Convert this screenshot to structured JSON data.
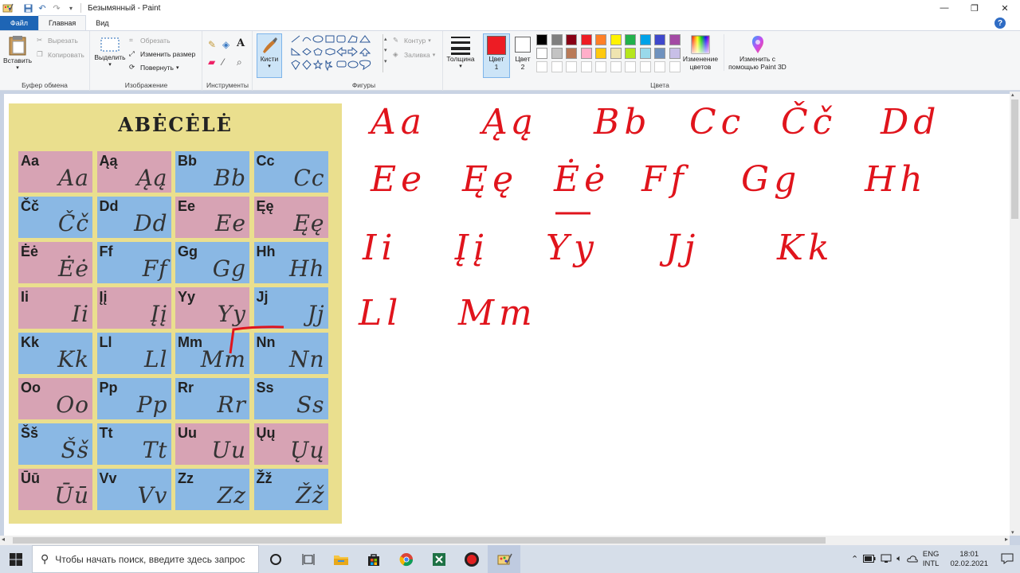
{
  "window": {
    "title": "Безымянный - Paint",
    "controls": {
      "minimize": "—",
      "maximize": "❐",
      "close": "✕"
    }
  },
  "tabs": [
    {
      "label": "Файл"
    },
    {
      "label": "Главная"
    },
    {
      "label": "Вид"
    }
  ],
  "ribbon": {
    "clipboard": {
      "paste": "Вставить",
      "cut": "Вырезать",
      "copy": "Копировать",
      "group": "Буфер обмена"
    },
    "image": {
      "select": "Выделить",
      "crop": "Обрезать",
      "resize": "Изменить размер",
      "rotate": "Повернуть",
      "group": "Изображение"
    },
    "tools": {
      "group": "Инструменты"
    },
    "brushes": {
      "label": "Кисти"
    },
    "shapes": {
      "outline": "Контур",
      "fill": "Заливка",
      "group": "Фигуры"
    },
    "thickness": {
      "label": "Толщина"
    },
    "color1": {
      "label1": "Цвет",
      "label2": "1",
      "value": "#ed1c24"
    },
    "color2": {
      "label1": "Цвет",
      "label2": "2",
      "value": "#ffffff"
    },
    "colors": {
      "group": "Цвета",
      "edit": "Изменение цветов",
      "paint3d": "Изменить с помощью Paint 3D"
    },
    "palette_row1": [
      "#000000",
      "#7f7f7f",
      "#880015",
      "#ed1c24",
      "#ff7f27",
      "#fff200",
      "#22b14c",
      "#00a2e8",
      "#3f48cc",
      "#a349a4"
    ],
    "palette_row2": [
      "#ffffff",
      "#c3c3c3",
      "#b97a57",
      "#ffaec9",
      "#ffc90e",
      "#efe4b0",
      "#b5e61d",
      "#99d9ea",
      "#7092be",
      "#c8bfe7"
    ]
  },
  "poster": {
    "title": "ABĖCĖLĖ",
    "cells": [
      {
        "print": "Aa",
        "script": "Aa",
        "color": "pink"
      },
      {
        "print": "Ąą",
        "script": "Ąą",
        "color": "pink"
      },
      {
        "print": "Bb",
        "script": "Bb",
        "color": "blue"
      },
      {
        "print": "Cc",
        "script": "Cc",
        "color": "blue"
      },
      {
        "print": "Čč",
        "script": "Čč",
        "color": "blue"
      },
      {
        "print": "Dd",
        "script": "Dd",
        "color": "blue"
      },
      {
        "print": "Ee",
        "script": "Ee",
        "color": "pink"
      },
      {
        "print": "Ęę",
        "script": "Ęę",
        "color": "pink"
      },
      {
        "print": "Ėė",
        "script": "Ėė",
        "color": "pink"
      },
      {
        "print": "Ff",
        "script": "Ff",
        "color": "blue"
      },
      {
        "print": "Gg",
        "script": "Gg",
        "color": "blue"
      },
      {
        "print": "Hh",
        "script": "Hh",
        "color": "blue"
      },
      {
        "print": "Ii",
        "script": "Ii",
        "color": "pink"
      },
      {
        "print": "Įį",
        "script": "Įį",
        "color": "pink"
      },
      {
        "print": "Yy",
        "script": "Yy",
        "color": "pink"
      },
      {
        "print": "Jj",
        "script": "Jj",
        "color": "blue"
      },
      {
        "print": "Kk",
        "script": "Kk",
        "color": "blue"
      },
      {
        "print": "Ll",
        "script": "Ll",
        "color": "blue"
      },
      {
        "print": "Mm",
        "script": "Mm",
        "color": "blue"
      },
      {
        "print": "Nn",
        "script": "Nn",
        "color": "blue"
      },
      {
        "print": "Oo",
        "script": "Oo",
        "color": "pink"
      },
      {
        "print": "Pp",
        "script": "Pp",
        "color": "blue"
      },
      {
        "print": "Rr",
        "script": "Rr",
        "color": "blue"
      },
      {
        "print": "Ss",
        "script": "Ss",
        "color": "blue"
      },
      {
        "print": "Šš",
        "script": "Šš",
        "color": "blue"
      },
      {
        "print": "Tt",
        "script": "Tt",
        "color": "blue"
      },
      {
        "print": "Uu",
        "script": "Uu",
        "color": "pink"
      },
      {
        "print": "Ųų",
        "script": "Ųų",
        "color": "pink"
      },
      {
        "print": "Ūū",
        "script": "Ūū",
        "color": "pink"
      },
      {
        "print": "Vv",
        "script": "Vv",
        "color": "blue"
      },
      {
        "print": "Zz",
        "script": "Zz",
        "color": "blue"
      },
      {
        "print": "Žž",
        "script": "Žž",
        "color": "blue"
      }
    ]
  },
  "handwriting": {
    "row1": [
      "Aa",
      "Ąą",
      "Bb",
      "Cc",
      "Čč",
      "Dd"
    ],
    "row2": [
      "Ee",
      "Ęę",
      "Ėė",
      "Ff",
      "Gg",
      "Hh"
    ],
    "row3": [
      "Ii",
      "Įį",
      "Yy",
      "Jj",
      "Kk"
    ],
    "row4": [
      "Ll",
      "Mm"
    ]
  },
  "taskbar": {
    "search_placeholder": "Чтобы начать поиск, введите здесь запрос",
    "lang1": "ENG",
    "lang2": "INTL",
    "time": "18:01",
    "date": "02.02.2021"
  }
}
